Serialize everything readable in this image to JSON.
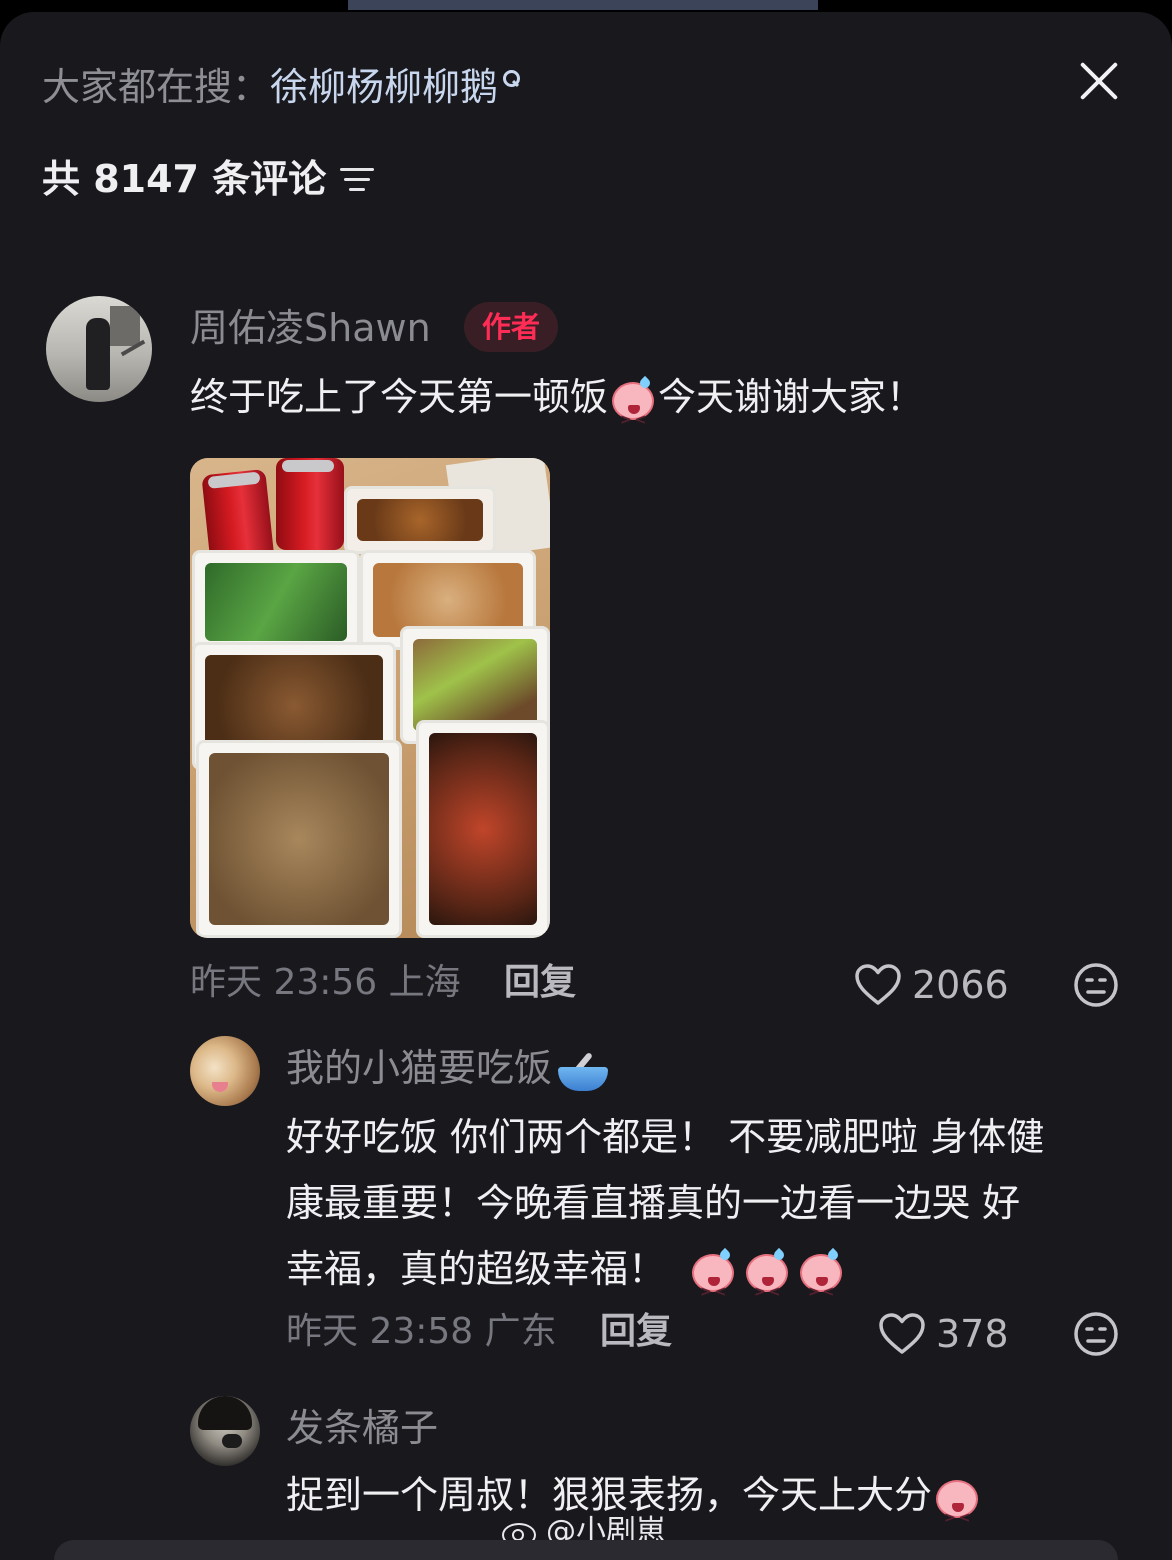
{
  "header": {
    "hot_search_label": "大家都在搜：",
    "hot_search_keyword": "徐柳杨柳柳鹅",
    "comment_count": "共 8147 条评论"
  },
  "comments": [
    {
      "username": "周佑凌Shawn",
      "badge": "作者",
      "text_part1": "终于吃上了今天第一顿饭",
      "text_part2": "今天谢谢大家！",
      "time": "昨天 23:56",
      "location": "上海",
      "reply_label": "回复",
      "likes": "2066"
    },
    {
      "username": "我的小猫要吃饭",
      "text_line1": "好好吃饭 你们两个都是！ 不要减肥啦 身体健",
      "text_line2": "康最重要！今晚看直播真的一边看一边哭 好",
      "text_line3": "幸福，真的超级幸福！",
      "time": "昨天 23:58",
      "location": "广东",
      "reply_label": "回复",
      "likes": "378"
    },
    {
      "username": "发条橘子",
      "text": "捉到一个周叔！狠狠表扬，今天上大分"
    }
  ],
  "watermark": "@小剧崽",
  "colors": {
    "panel_bg": "#18181d",
    "author_badge": "#ff2d55",
    "keyword": "#c8d7ee"
  }
}
